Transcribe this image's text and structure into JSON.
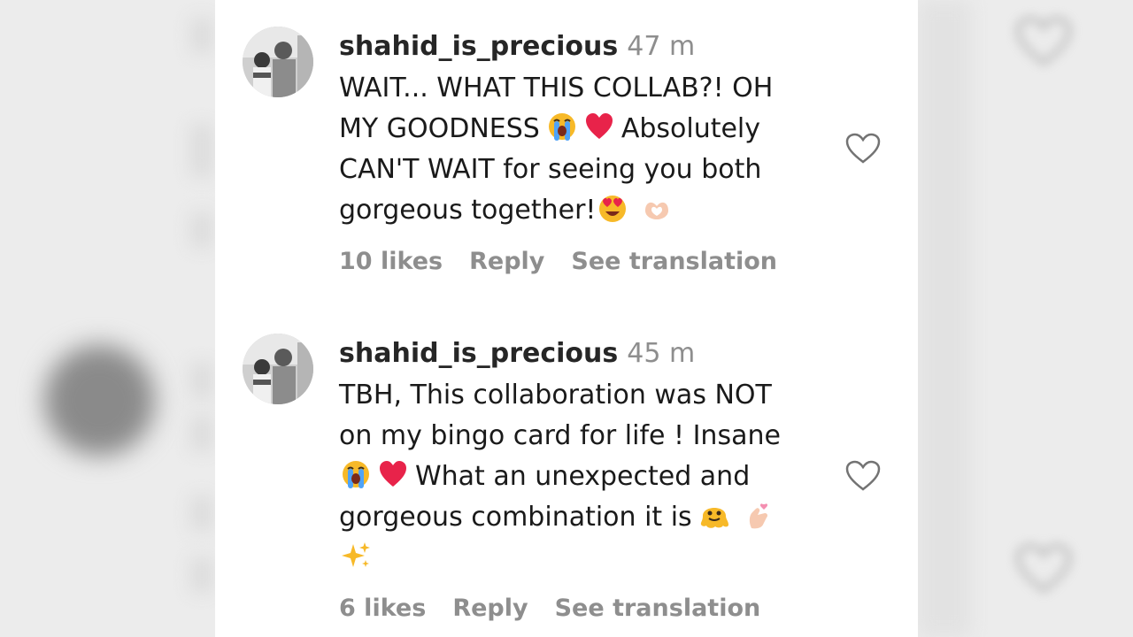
{
  "comments": [
    {
      "username": "shahid_is_precious",
      "time": "47 m",
      "line1": "WAIT... WHAT THIS COLLAB?! OH",
      "line2_a": "MY GOODNESS",
      "line2_b": "Absolutely",
      "line3": "CAN'T WAIT for seeing you both",
      "line4": "gorgeous together!",
      "likes": "10 likes",
      "reply": "Reply",
      "translate": "See translation"
    },
    {
      "username": "shahid_is_precious",
      "time": "45 m",
      "line1": "TBH, This collaboration was NOT",
      "line2": "on my bingo card for life ! Insane",
      "line3_b": "What an unexpected and",
      "line4": "gorgeous combination it is",
      "likes": "6 likes",
      "reply": "Reply",
      "translate": "See translation"
    }
  ],
  "colors": {
    "text": "#1a1a1a",
    "username": "#262626",
    "muted": "#8e8e8e",
    "heart_red": "#e8234a",
    "emoji_yellow": "#f7b928"
  },
  "icons": [
    "loudly-crying-face-icon",
    "red-heart-icon",
    "heart-eyes-face-icon",
    "heart-hands-icon",
    "melting-face-icon",
    "finger-heart-icon",
    "sparkles-icon",
    "heart-outline-icon"
  ]
}
